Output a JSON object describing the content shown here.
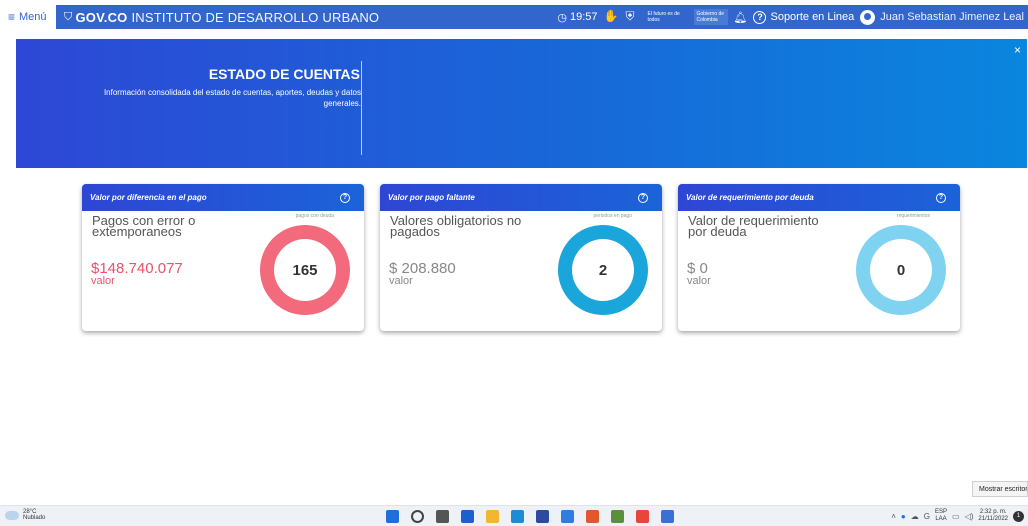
{
  "topbar": {
    "menu_label": "Menú",
    "gov_label": "GOV.CO",
    "institute": "INSTITUTO DE DESARROLLO URBANO",
    "clock": "19:57",
    "futuro_text": "El futuro es de todos",
    "gobierno_text": "Gobierno de Colombia",
    "soporte_label": "Soporte en Linea",
    "user_name": "Juan Sebastian Jimenez Leal",
    "colors": {
      "bar": "#3366cc"
    }
  },
  "banner": {
    "title": "ESTADO DE CUENTAS",
    "description": "Información consolidada del estado de cuentas, aportes, deudas y datos generales.",
    "close": "×"
  },
  "cards": [
    {
      "header": "Valor por diferencia en el pago",
      "label": "Pagos con error o extemporaneos",
      "amount": "$148.740.077",
      "sub": "valor",
      "donut_caption": "pagos con deuda",
      "count": "165",
      "text_color": "#e9536a",
      "ring_color": "#f26a7c"
    },
    {
      "header": "Valor por pago faltante",
      "label": "Valores obligatorios no pagados",
      "amount": "$ 208.880",
      "sub": "valor",
      "donut_caption": "periodos en pago",
      "count": "2",
      "text_color": "#888888",
      "ring_color": "#1aa6db"
    },
    {
      "header": "Valor de requerimiento por deuda",
      "label": "Valor de requerimiento por deuda",
      "amount": "$ 0",
      "sub": "valor",
      "donut_caption": "requerimientos",
      "count": "0",
      "text_color": "#888888",
      "ring_color": "#7fd3f0"
    }
  ],
  "desktop": {
    "show_desktop": "Mostrar escritori"
  },
  "taskbar": {
    "weather_temp": "28°C",
    "weather_desc": "Nublado",
    "lang_top": "ESP",
    "lang_bottom": "LAA",
    "time": "2:32 p. m.",
    "date": "21/11/2022",
    "notifications": "1",
    "icon_colors": [
      "#1e6fd9",
      "#444444",
      "#555555",
      "#1e5fd0",
      "#f2b632",
      "#1f8ad6",
      "#2b4aa0",
      "#2e7de0",
      "#e4572e",
      "#5a8f3c",
      "#e8453c",
      "#3b6fd8"
    ]
  }
}
